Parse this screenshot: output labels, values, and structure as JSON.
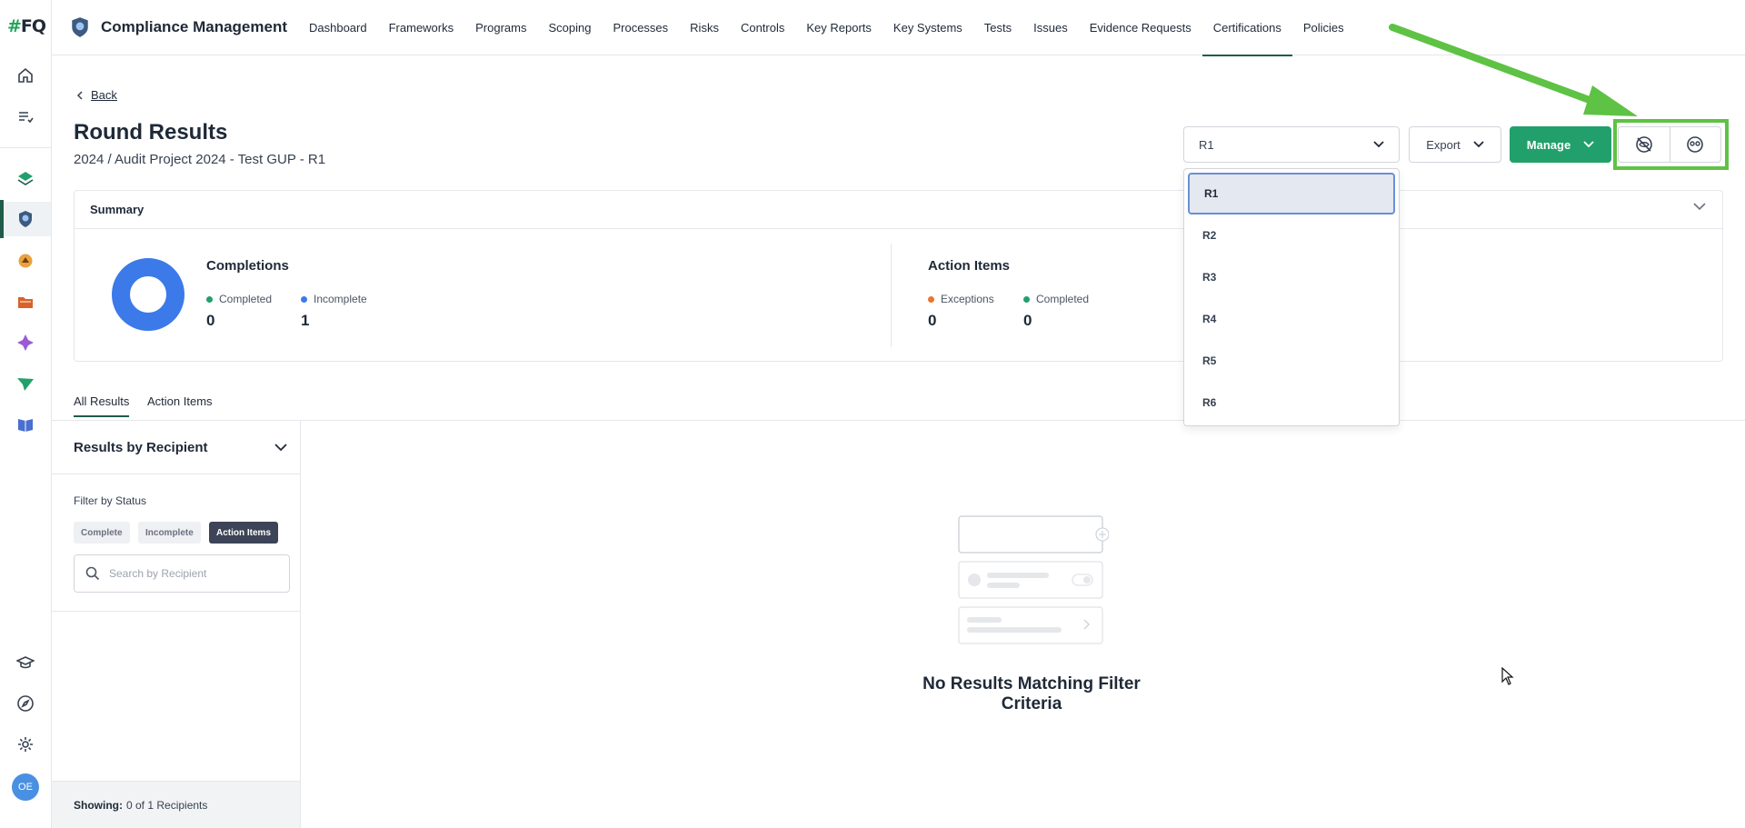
{
  "brand": {
    "logo_hash": "#",
    "logo_text": "FQ",
    "accent": "#22a06b",
    "nav_accent": "#1f5c4a",
    "highlight": "#5ec244"
  },
  "user": {
    "initials": "OE",
    "avatar_color": "#4a90e2"
  },
  "app": {
    "title": "Compliance Management"
  },
  "nav": {
    "items": [
      {
        "label": "Dashboard"
      },
      {
        "label": "Frameworks"
      },
      {
        "label": "Programs"
      },
      {
        "label": "Scoping"
      },
      {
        "label": "Processes"
      },
      {
        "label": "Risks"
      },
      {
        "label": "Controls"
      },
      {
        "label": "Key Reports"
      },
      {
        "label": "Key Systems"
      },
      {
        "label": "Tests"
      },
      {
        "label": "Issues"
      },
      {
        "label": "Evidence Requests"
      },
      {
        "label": "Certifications",
        "active": true
      },
      {
        "label": "Policies"
      }
    ]
  },
  "rail": {
    "top_icons": [
      "home-icon",
      "list-check-icon"
    ],
    "module_icons": [
      "layers-icon",
      "certification-badge-icon",
      "diamond-ring-icon",
      "folder-icon",
      "sparkle-icon",
      "paper-plane-icon",
      "book-icon"
    ],
    "bottom_icons": [
      "graduation-cap-icon",
      "compass-icon",
      "gear-icon"
    ]
  },
  "header": {
    "back_label": "Back",
    "title": "Round Results",
    "subtitle": "2024 / Audit Project 2024 - Test GUP - R1",
    "round_select": {
      "value": "R1",
      "options": [
        "R1",
        "R2",
        "R3",
        "R4",
        "R5",
        "R6"
      ]
    },
    "export_label": "Export",
    "manage_label": "Manage",
    "icon_buttons": [
      "hide-icon",
      "user-view-icon"
    ]
  },
  "summary": {
    "title": "Summary",
    "completions": {
      "title": "Completions",
      "completed_label": "Completed",
      "completed_value": "0",
      "incomplete_label": "Incomplete",
      "incomplete_value": "1",
      "colors": {
        "completed": "#22a06b",
        "incomplete": "#3b7ae8"
      }
    },
    "action_items": {
      "title": "Action Items",
      "exceptions_label": "Exceptions",
      "exceptions_value": "0",
      "completed_label": "Completed",
      "completed_value": "0",
      "colors": {
        "exceptions": "#e8772e",
        "completed": "#22a06b"
      }
    }
  },
  "tabs": [
    {
      "label": "All Results",
      "active": true
    },
    {
      "label": "Action Items"
    }
  ],
  "results_panel": {
    "title": "Results by Recipient",
    "filter_label": "Filter by Status",
    "chips": [
      {
        "label": "Complete"
      },
      {
        "label": "Incomplete"
      },
      {
        "label": "Action Items",
        "active": true
      }
    ],
    "search_placeholder": "Search by Recipient",
    "footer_label": "Showing:",
    "footer_value": "0 of 1 Recipients"
  },
  "empty_state": {
    "message": "No Results Matching Filter Criteria"
  }
}
